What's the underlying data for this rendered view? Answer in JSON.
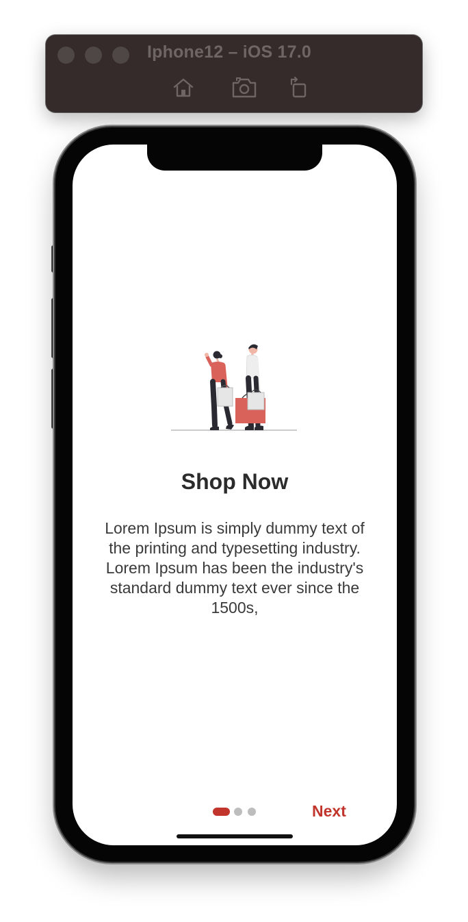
{
  "simulator": {
    "title": "Iphone12 – iOS 17.0",
    "toolbar_icons": [
      "home-icon",
      "screenshot-icon",
      "rotate-icon"
    ]
  },
  "onboarding": {
    "illustration": "shopping-couple-illustration",
    "title": "Shop Now",
    "description": "Lorem Ipsum is simply dummy text of the printing and typesetting industry. Lorem Ipsum has been the industry's standard dummy text ever since the 1500s,",
    "page_indicator": {
      "current": 1,
      "total": 3
    },
    "next_label": "Next"
  },
  "colors": {
    "accent": "#c2352d",
    "simulator_bar": "#362b2b",
    "inactive_dot": "#bdbdbd",
    "text_primary": "#2b2b2b"
  }
}
